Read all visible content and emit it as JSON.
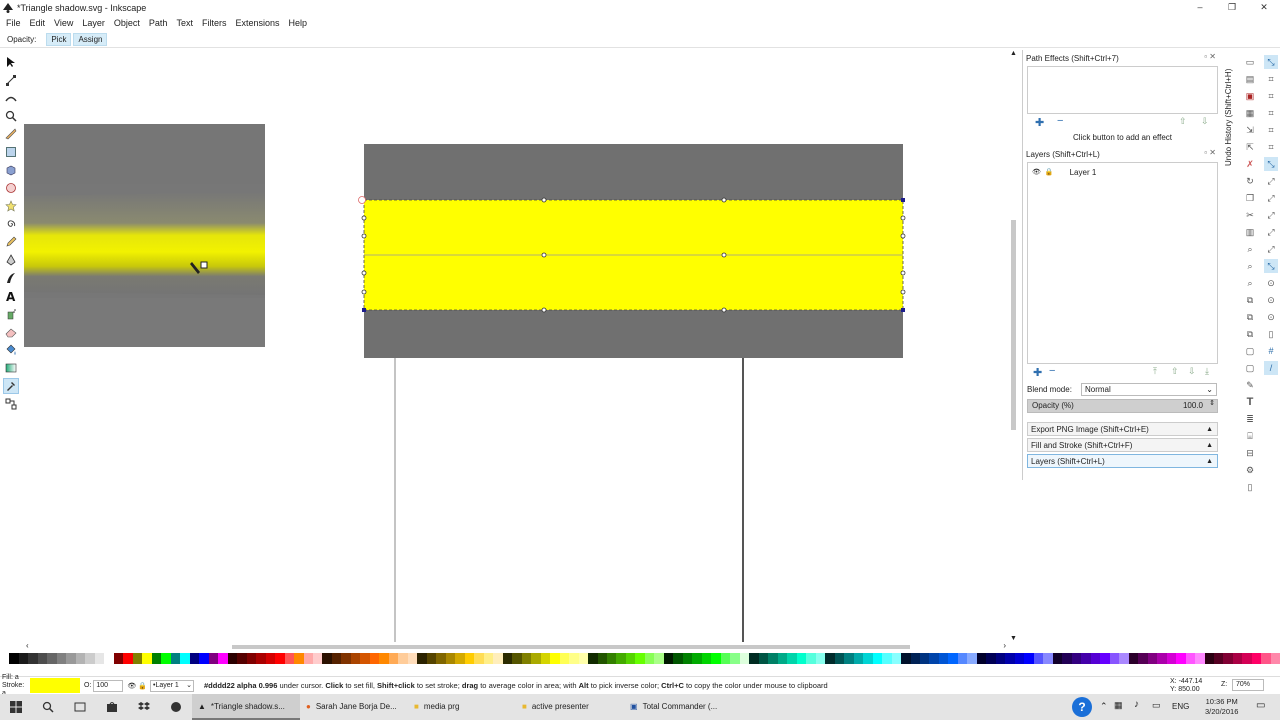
{
  "window": {
    "title": "*Triangle shadow.svg - Inkscape",
    "controls": [
      "–",
      "❐",
      "✕"
    ]
  },
  "menu": [
    "File",
    "Edit",
    "View",
    "Layer",
    "Object",
    "Path",
    "Text",
    "Filters",
    "Extensions",
    "Help"
  ],
  "tool_controls": {
    "opacity_label": "Opacity:",
    "pick_label": "Pick",
    "assign_label": "Assign"
  },
  "tools": [
    "selector-tool",
    "node-tool",
    "tweak-tool",
    "zoom-tool",
    "measure-tool",
    "rectangle-tool",
    "box-tool",
    "ellipse-tool",
    "star-tool",
    "spiral-tool",
    "pencil-tool",
    "pen-tool",
    "calligraphy-tool",
    "text-tool",
    "spray-tool",
    "eraser-tool",
    "bucket-tool",
    "gradient-tool",
    "dropper-tool",
    "connector-tool"
  ],
  "colors": {
    "yellow": "#ffff00",
    "gray": "#707070",
    "selection": "#1e1e8c"
  },
  "path_effects": {
    "title": "Path Effects  (Shift+Ctrl+7)",
    "hint": "Click button to add an effect"
  },
  "layers_panel": {
    "title": "Layers (Shift+Ctrl+L)",
    "layer_name": "Layer 1",
    "blend_label": "Blend mode:",
    "blend_value": "Normal",
    "opacity_label": "Opacity (%)",
    "opacity_value": "100.0",
    "opacity_fraction": 1.0
  },
  "collapsed_panels": [
    "Export PNG Image (Shift+Ctrl+E)",
    "Fill and Stroke (Shift+Ctrl+F)",
    "Layers (Shift+Ctrl+L)"
  ],
  "undo_history_label": "Undo History (Shift+Ctrl+H)",
  "status": {
    "fill_label": "Fill:",
    "stroke_label": "Stroke:",
    "fill_value": "a",
    "stroke_value": "a",
    "opacity_prefix": "O:",
    "opacity_value": "100",
    "layer_name": "•Layer 1",
    "message_parts": [
      {
        "t": "#dddd22 alpha 0.996",
        "b": true
      },
      {
        "t": " under cursor. ",
        "b": false
      },
      {
        "t": "Click",
        "b": true
      },
      {
        "t": " to set fill, ",
        "b": false
      },
      {
        "t": "Shift+click",
        "b": true
      },
      {
        "t": " to set stroke; ",
        "b": false
      },
      {
        "t": "drag",
        "b": true
      },
      {
        "t": " to average color in area; with ",
        "b": false
      },
      {
        "t": "Alt",
        "b": true
      },
      {
        "t": " to pick inverse color; ",
        "b": false
      },
      {
        "t": "Ctrl+C",
        "b": true
      },
      {
        "t": " to copy the color under mouse to clipboard",
        "b": false
      }
    ],
    "x_label": "X:",
    "x_value": "-447.14",
    "y_label": "Y:",
    "y_value": "850.00",
    "z_label": "Z:",
    "zoom_value": "70%"
  },
  "taskbar": {
    "tasks": [
      "*Triangle shadow.s...",
      "Sarah Jane Borja De...",
      "media prg",
      "active presenter",
      "Total Commander (..."
    ],
    "lang": "ENG",
    "time": "10:36 PM",
    "date": "3/20/2016"
  }
}
